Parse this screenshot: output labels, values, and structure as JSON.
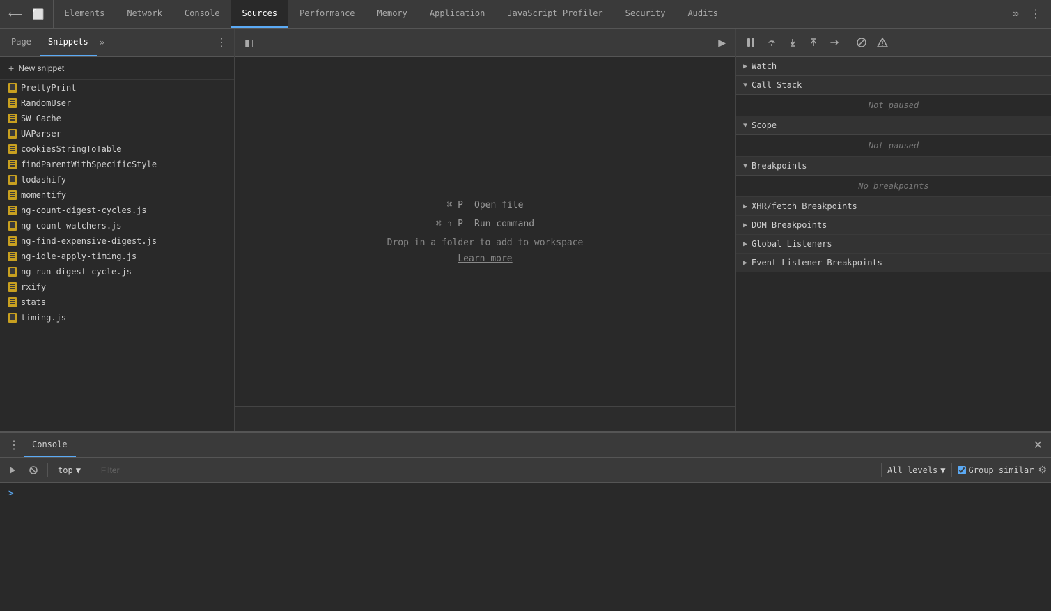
{
  "topTabs": {
    "items": [
      {
        "label": "Elements",
        "active": false
      },
      {
        "label": "Network",
        "active": false
      },
      {
        "label": "Console",
        "active": false
      },
      {
        "label": "Sources",
        "active": true
      },
      {
        "label": "Performance",
        "active": false
      },
      {
        "label": "Memory",
        "active": false
      },
      {
        "label": "Application",
        "active": false
      },
      {
        "label": "JavaScript Profiler",
        "active": false
      },
      {
        "label": "Security",
        "active": false
      },
      {
        "label": "Audits",
        "active": false
      }
    ]
  },
  "subTabs": {
    "items": [
      {
        "label": "Page",
        "active": false
      },
      {
        "label": "Snippets",
        "active": true
      }
    ]
  },
  "newSnippet": {
    "label": "New snippet"
  },
  "fileList": {
    "items": [
      {
        "name": "PrettyPrint"
      },
      {
        "name": "RandomUser"
      },
      {
        "name": "SW Cache"
      },
      {
        "name": "UAParser"
      },
      {
        "name": "cookiesStringToTable"
      },
      {
        "name": "findParentWithSpecificStyle"
      },
      {
        "name": "lodashify"
      },
      {
        "name": "momentify"
      },
      {
        "name": "ng-count-digest-cycles.js"
      },
      {
        "name": "ng-count-watchers.js"
      },
      {
        "name": "ng-find-expensive-digest.js"
      },
      {
        "name": "ng-idle-apply-timing.js"
      },
      {
        "name": "ng-run-digest-cycle.js"
      },
      {
        "name": "rxify"
      },
      {
        "name": "stats"
      },
      {
        "name": "timing.js"
      }
    ]
  },
  "editor": {
    "shortcut1": {
      "keys": "⌘ P",
      "action": "Open file"
    },
    "shortcut2": {
      "keys": "⌘ ⇧ P",
      "action": "Run command"
    },
    "dropText": "Drop in a folder to add to workspace",
    "learnMore": "Learn more"
  },
  "rightPanel": {
    "debugButtons": [
      {
        "icon": "⏸",
        "name": "pause-button"
      },
      {
        "icon": "⌒",
        "name": "step-over-button"
      },
      {
        "icon": "↓",
        "name": "step-into-button"
      },
      {
        "icon": "↑",
        "name": "step-out-button"
      },
      {
        "icon": "⇄",
        "name": "step-button"
      },
      {
        "icon": "⊘",
        "name": "deactivate-button"
      },
      {
        "icon": "⏸",
        "name": "pause-on-exceptions-button"
      }
    ],
    "sections": [
      {
        "id": "watch",
        "label": "Watch",
        "collapsed": false,
        "content": null,
        "empty": null
      },
      {
        "id": "callstack",
        "label": "Call Stack",
        "collapsed": false,
        "content": "Not paused",
        "empty": null
      },
      {
        "id": "scope",
        "label": "Scope",
        "collapsed": false,
        "content": "Not paused",
        "empty": null
      },
      {
        "id": "breakpoints",
        "label": "Breakpoints",
        "collapsed": false,
        "content": null,
        "empty": "No breakpoints"
      },
      {
        "id": "xhr-fetch",
        "label": "XHR/fetch Breakpoints",
        "collapsed": true,
        "content": null,
        "empty": null
      },
      {
        "id": "dom-breakpoints",
        "label": "DOM Breakpoints",
        "collapsed": true,
        "content": null,
        "empty": null
      },
      {
        "id": "global-listeners",
        "label": "Global Listeners",
        "collapsed": true,
        "content": null,
        "empty": null
      },
      {
        "id": "event-listener-breakpoints",
        "label": "Event Listener Breakpoints",
        "collapsed": true,
        "content": null,
        "empty": null
      }
    ]
  },
  "console": {
    "tab": "Console",
    "contextLabel": "top",
    "filterPlaceholder": "Filter",
    "levelsLabel": "All levels",
    "groupSimilarLabel": "Group similar",
    "promptSymbol": ">"
  }
}
